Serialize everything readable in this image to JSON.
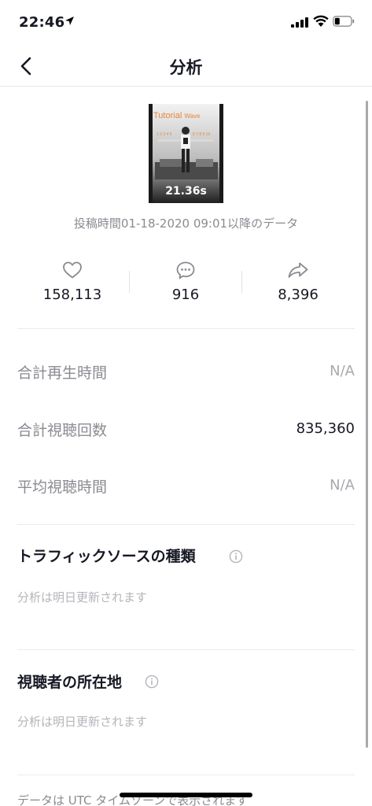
{
  "status_bar": {
    "time": "22:46",
    "icons": [
      "location-arrow-icon",
      "signal-icon",
      "wifi-icon",
      "battery-icon"
    ]
  },
  "nav": {
    "title": "分析",
    "back_icon": "chevron-left-icon"
  },
  "video": {
    "overlay_title": "Tutorial",
    "overlay_subtitle": "Wave",
    "duration": "21.36s"
  },
  "post_meta": "投稿時間01-18-2020 09:01以降のデータ",
  "stats": [
    {
      "icon": "heart-icon",
      "value": "158,113"
    },
    {
      "icon": "comment-icon",
      "value": "916"
    },
    {
      "icon": "share-icon",
      "value": "8,396"
    }
  ],
  "metrics": [
    {
      "label": "合計再生時間",
      "value": "N/A"
    },
    {
      "label": "合計視聴回数",
      "value": "835,360"
    },
    {
      "label": "平均視聴時間",
      "value": "N/A"
    }
  ],
  "sections": [
    {
      "title": "トラフィックソースの種類",
      "note": "分析は明日更新されます"
    },
    {
      "title": "視聴者の所在地",
      "note": "分析は明日更新されます"
    }
  ],
  "footer_note": "データは UTC タイムゾーンで表示されます",
  "colors": {
    "text_primary": "#161823",
    "text_secondary": "#8a8b91",
    "text_muted": "#b4b5ba",
    "thumbnail_title": "#e8873a"
  }
}
